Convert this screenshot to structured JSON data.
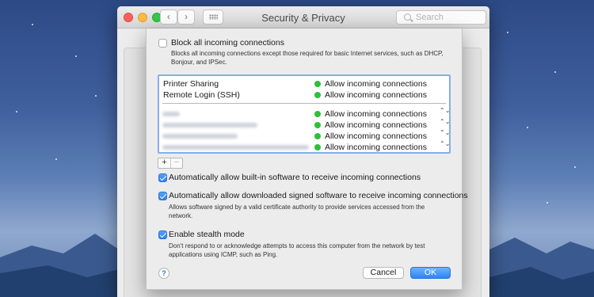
{
  "window": {
    "title": "Security & Privacy",
    "search_placeholder": "Search",
    "back_glyph": "‹",
    "forward_glyph": "›"
  },
  "firewall_options": {
    "block_all": {
      "label": "Block all incoming connections",
      "checked": false,
      "description": "Blocks all incoming connections except those required for basic Internet services, such as DHCP, Bonjour, and IPSec."
    },
    "services": [
      {
        "name": "Printer Sharing",
        "status": "Allow incoming connections",
        "status_color": "#2fbf3a"
      },
      {
        "name": "Remote Login (SSH)",
        "status": "Allow incoming connections",
        "status_color": "#2fbf3a"
      }
    ],
    "apps": [
      {
        "status": "Allow incoming connections",
        "stepper": "⌃⌄",
        "status_color": "#2fbf3a"
      },
      {
        "status": "Allow incoming connections",
        "stepper": "⌃⌄",
        "status_color": "#2fbf3a"
      },
      {
        "status": "Allow incoming connections",
        "stepper": "⌃⌄",
        "status_color": "#2fbf3a"
      },
      {
        "status": "Allow incoming connections",
        "stepper": "⌃⌄",
        "status_color": "#2fbf3a"
      }
    ],
    "add_label": "+",
    "remove_label": "−",
    "auto_builtin": {
      "label": "Automatically allow built-in software to receive incoming connections",
      "checked": true
    },
    "auto_signed": {
      "label": "Automatically allow downloaded signed software to receive incoming connections",
      "checked": true,
      "description": "Allows software signed by a valid certificate authority to provide services accessed from the network."
    },
    "stealth": {
      "label": "Enable stealth mode",
      "checked": true,
      "description": "Don't respond to or acknowledge attempts to access this computer from the network by test applications using ICMP, such as Ping."
    },
    "help_label": "?",
    "cancel_label": "Cancel",
    "ok_label": "OK"
  },
  "colors": {
    "accent": "#2f84f5",
    "status_green": "#2fbf3a"
  }
}
